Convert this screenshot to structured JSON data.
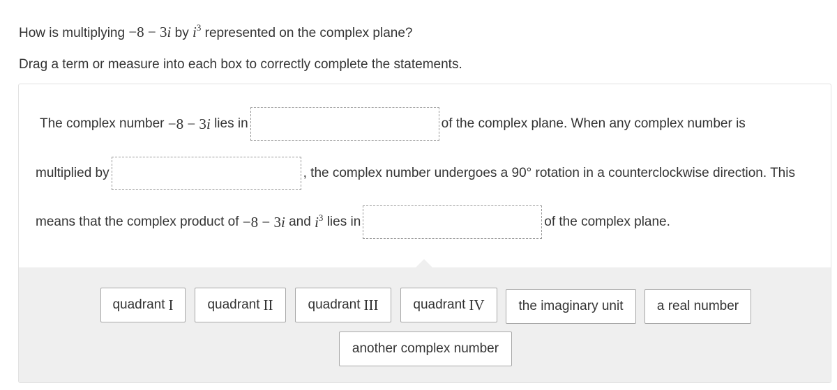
{
  "question": {
    "prefix": "How is multiplying",
    "expr1": "−8 − 3",
    "expr1_var": "i",
    "mid": "by",
    "base": "i",
    "exponent": "3",
    "suffix": "represented on the complex plane?"
  },
  "instruction": "Drag a term or measure into each box to correctly complete the statements.",
  "statements": [
    {
      "before": "The complex number",
      "math": "−8 − 3",
      "math_var": "i",
      "before2": "lies in",
      "after": "of the complex plane. When any complex number is"
    },
    {
      "before": "multiplied by",
      "after": ", the complex number undergoes a 90° rotation in a counterclockwise direction. This"
    },
    {
      "before": "means that the complex product of",
      "math": "−8 − 3",
      "math_var": "i",
      "and": "and",
      "base": "i",
      "exponent": "3",
      "before2": "lies in",
      "after": "of the complex plane."
    }
  ],
  "tiles": [
    {
      "word": "quadrant",
      "roman": "I"
    },
    {
      "word": "quadrant",
      "roman": "II"
    },
    {
      "word": "quadrant",
      "roman": "III"
    },
    {
      "word": "quadrant",
      "roman": "IV"
    },
    {
      "word": "the imaginary unit",
      "roman": ""
    },
    {
      "word": "a real number",
      "roman": ""
    },
    {
      "word": "another complex number",
      "roman": ""
    }
  ]
}
